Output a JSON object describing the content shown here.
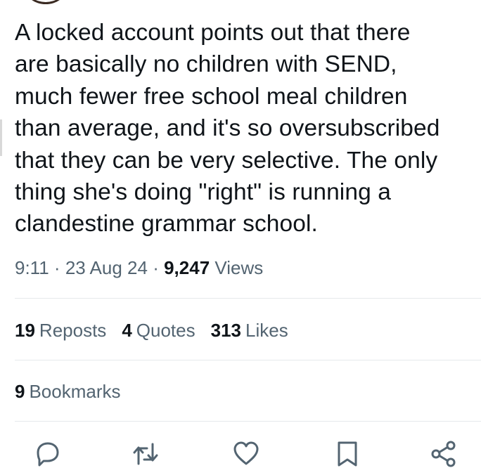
{
  "tweet": {
    "text_lines": [
      "A locked account points out that there",
      "are basically no children with SEND,",
      "much fewer free school meal children",
      "than average, and it's so oversubscribed",
      "that they can be very selective. The only",
      "thing she's doing \"right\" is running a",
      "clandestine grammar school."
    ],
    "time": "9:11",
    "date": "23 Aug 24",
    "views_count": "9,247",
    "views_label": "Views",
    "separator": "·"
  },
  "stats": {
    "reposts_count": "19",
    "reposts_label": "Reposts",
    "quotes_count": "4",
    "quotes_label": "Quotes",
    "likes_count": "313",
    "likes_label": "Likes",
    "bookmarks_count": "9",
    "bookmarks_label": "Bookmarks"
  },
  "actions": {
    "icons": [
      "reply-icon",
      "repost-icon",
      "like-icon",
      "bookmark-icon",
      "share-icon"
    ]
  },
  "colors": {
    "text_primary": "#0f1419",
    "text_secondary": "#536471",
    "divider": "#e6e9eb"
  }
}
